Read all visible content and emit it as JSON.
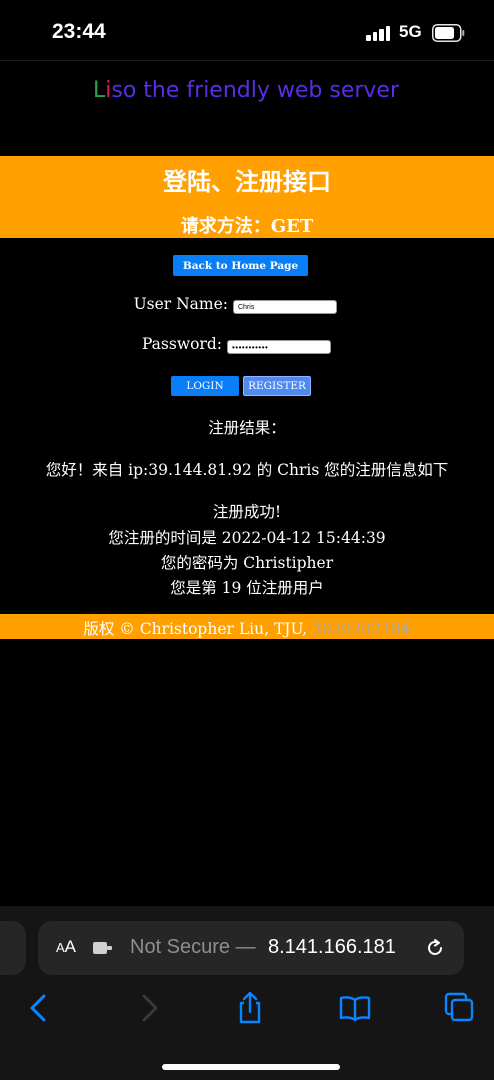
{
  "status_bar": {
    "time": "23:44",
    "network": "5G"
  },
  "logo": {
    "l": "L",
    "i": "i",
    "rest": "so the friendly web server"
  },
  "header": {
    "title": "登陆、注册接口",
    "method": "请求方法：GET"
  },
  "form": {
    "back_label": "Back to Home Page",
    "username_label": "User Name:",
    "username_value": "Chris",
    "password_label": "Password:",
    "password_value": "•••••••••••",
    "login_label": "LOGIN",
    "register_label": "REGISTER"
  },
  "result": {
    "heading": "注册结果：",
    "greeting": "您好！来自 ip:39.144.81.92 的 Chris 您的注册信息如下",
    "success": "注册成功!",
    "time": "您注册的时间是 2022-04-12 15:44:39",
    "password": "您的密码为 Christipher",
    "count": "您是第 19 位注册用户"
  },
  "footer": {
    "copyright": "版权 © Christopher Liu, TJU, ",
    "student_id": "3020202184"
  },
  "browser": {
    "aa": "A",
    "aa_big": "A",
    "not_secure": "Not Secure —",
    "url": "8.141.166.181"
  },
  "colors": {
    "accent_orange": "#ffa000",
    "button_blue": "#0a7ef6",
    "ios_blue": "#0a84ff"
  },
  "icons": [
    "reload-icon",
    "back-icon",
    "forward-icon",
    "share-icon",
    "bookmarks-icon",
    "tabs-icon",
    "extension-icon"
  ]
}
